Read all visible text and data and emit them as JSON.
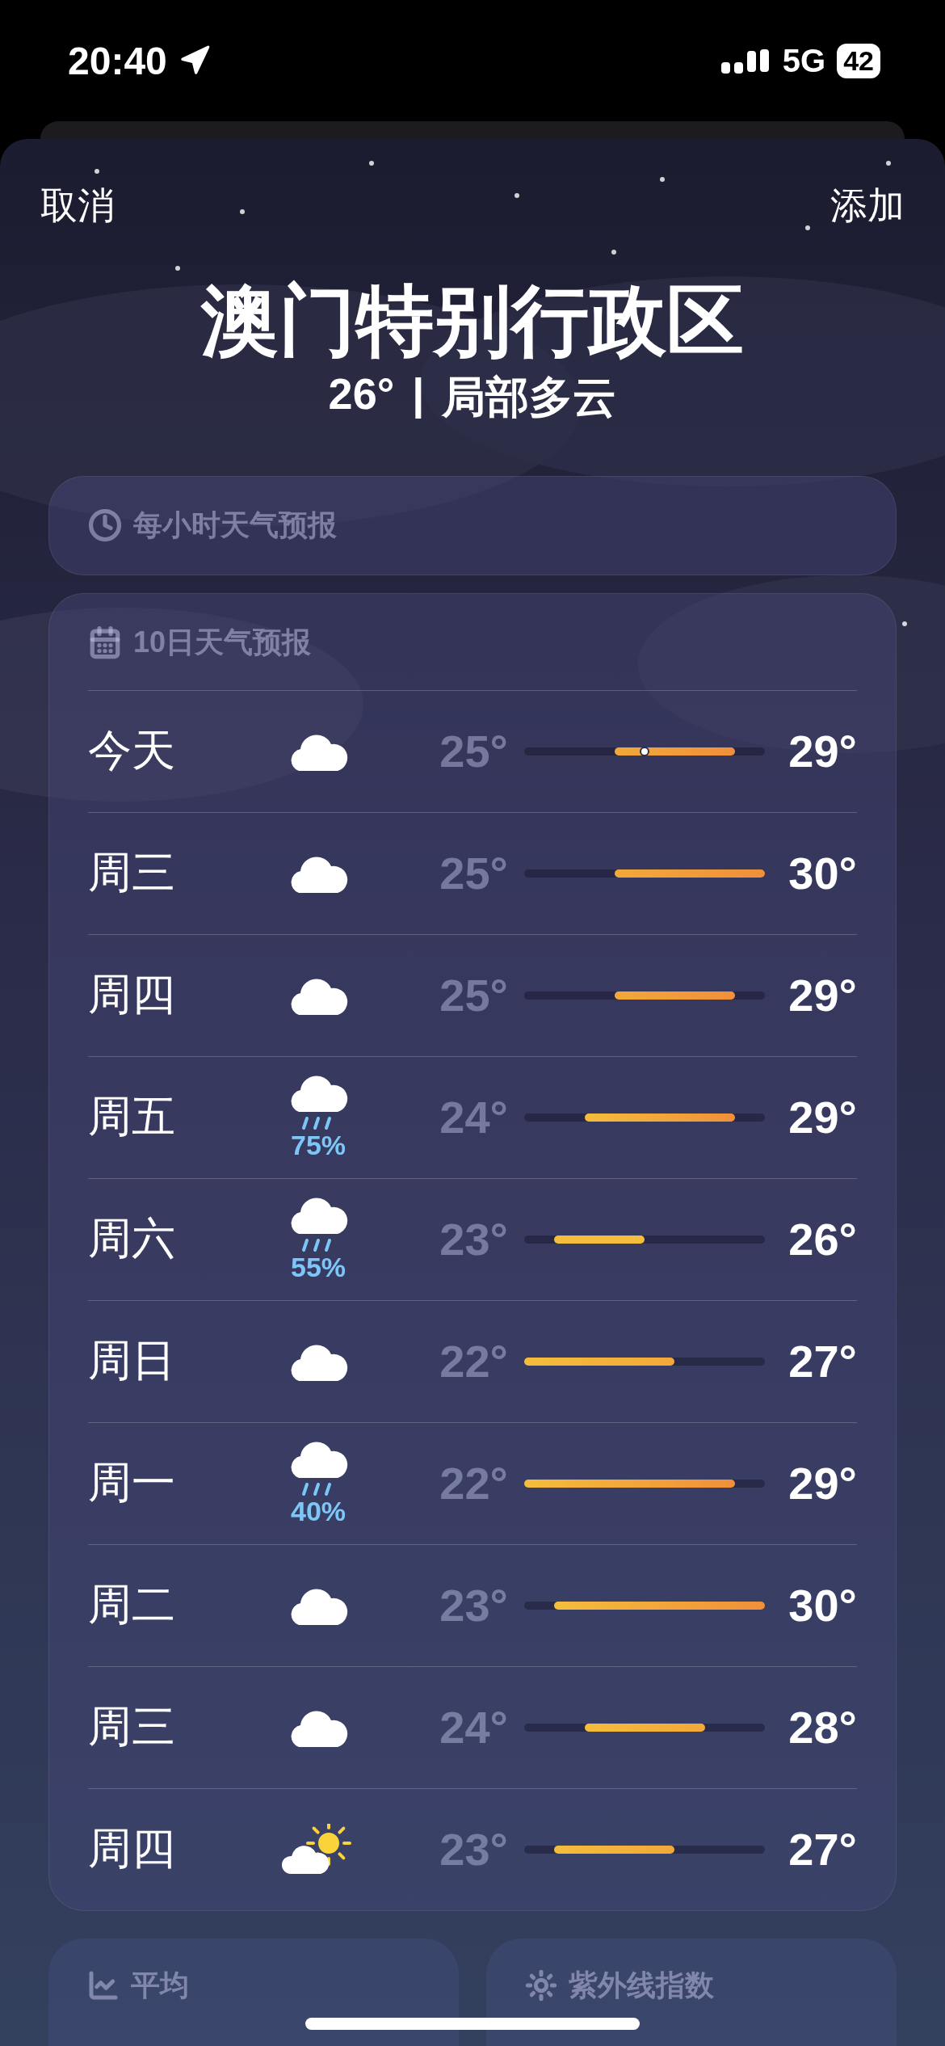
{
  "status_bar": {
    "time": "20:40",
    "network": "5G",
    "battery": "42"
  },
  "nav": {
    "cancel": "取消",
    "add": "添加"
  },
  "location": {
    "name": "澳门特别行政区",
    "temperature": "26°",
    "separator": "|",
    "condition": "局部多云"
  },
  "hourly": {
    "title": "每小时天气预报"
  },
  "ten_day": {
    "title": "10日天气预报",
    "days": [
      {
        "day": "今天",
        "kind": "cloud",
        "low": "25°",
        "high": "29°",
        "current": true
      },
      {
        "day": "周三",
        "kind": "cloud",
        "low": "25°",
        "high": "30°",
        "current": false
      },
      {
        "day": "周四",
        "kind": "cloud",
        "low": "25°",
        "high": "29°",
        "current": false
      },
      {
        "day": "周五",
        "kind": "rain",
        "precipitation": "75%",
        "low": "24°",
        "high": "29°",
        "current": false
      },
      {
        "day": "周六",
        "kind": "rain",
        "precipitation": "55%",
        "low": "23°",
        "high": "26°",
        "current": false
      },
      {
        "day": "周日",
        "kind": "cloud",
        "low": "22°",
        "high": "27°",
        "current": false
      },
      {
        "day": "周一",
        "kind": "rain",
        "precipitation": "40%",
        "low": "22°",
        "high": "29°",
        "current": false
      },
      {
        "day": "周二",
        "kind": "cloud",
        "low": "23°",
        "high": "30°",
        "current": false
      },
      {
        "day": "周三",
        "kind": "cloud",
        "low": "24°",
        "high": "28°",
        "current": false
      },
      {
        "day": "周四",
        "kind": "partly_sunny",
        "low": "23°",
        "high": "27°",
        "current": false
      }
    ]
  },
  "tiles": [
    {
      "kind": "averages",
      "title": "平均"
    },
    {
      "kind": "uv",
      "title": "紫外线指数"
    }
  ]
}
